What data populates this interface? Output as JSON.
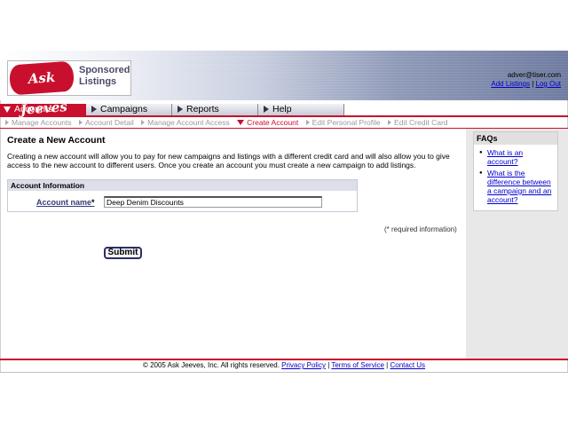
{
  "header": {
    "logo_text": "Ask Jeeves",
    "logo_tagline_1": "Sponsored",
    "logo_tagline_2": "Listings",
    "user_email": "adver@tiser.com",
    "add_listings_link": "Add Listings",
    "separator": "|",
    "logout_link": "Log Out"
  },
  "tabs": [
    {
      "label": "Accounts",
      "active": true
    },
    {
      "label": "Campaigns",
      "active": false
    },
    {
      "label": "Reports",
      "active": false
    },
    {
      "label": "Help",
      "active": false
    }
  ],
  "subnav": [
    {
      "label": "Manage Accounts",
      "current": false
    },
    {
      "label": "Account Detail",
      "current": false
    },
    {
      "label": "Manage Account Access",
      "current": false
    },
    {
      "label": "Create Account",
      "current": true
    },
    {
      "label": "Edit Personal Profile",
      "current": false
    },
    {
      "label": "Edit Credit Card",
      "current": false
    }
  ],
  "main": {
    "title": "Create a New Account",
    "intro": "Creating a new account will allow you to pay for new campaigns and listings with a different credit card and will also allow you to give access to the new account to different users. Once you create an account you must create a new campaign to add listings.",
    "section_header": "Account Information",
    "field_label": "Account name",
    "required_mark": "*",
    "field_value": "Deep Denim Discounts",
    "required_note": "(* required information)",
    "submit_label": "Submit"
  },
  "sidebar": {
    "title": "FAQs",
    "items": [
      "What is an account?",
      "What is the difference between a campaign and an account?"
    ]
  },
  "footer": {
    "copyright": "© 2005 Ask Jeeves, Inc. All rights reserved.",
    "links": [
      "Privacy Policy",
      "Terms of Service",
      "Contact Us"
    ],
    "separator": "|"
  },
  "colors": {
    "brand_red": "#c8102e",
    "link_blue": "#0000cc"
  }
}
